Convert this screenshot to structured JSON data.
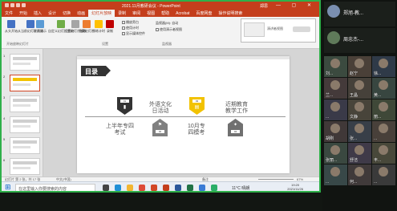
{
  "window": {
    "title": "2021.11月教研会议 - PowerPoint",
    "user_label": "郑思",
    "controls": "— ▢ ✕"
  },
  "menu": {
    "tabs": [
      "文件",
      "开始",
      "插入",
      "设计",
      "切换",
      "动画",
      "幻灯片放映",
      "录制",
      "审阅",
      "视图",
      "帮助",
      "Acrobat",
      "百度网盘",
      "操作说明搜索"
    ],
    "active_index": 6
  },
  "ribbon": {
    "buttons": [
      {
        "label": "从头开始",
        "color": "#4472c4"
      },
      {
        "label": "从当前幻灯片开始",
        "color": "#4472c4"
      },
      {
        "label": "联机演示",
        "color": "#5b9bd5"
      },
      {
        "label": "自定义幻灯片放映",
        "color": "#70ad47"
      },
      {
        "label": "设置幻灯片放映",
        "color": "#a5a5a5"
      },
      {
        "label": "隐藏幻灯片",
        "color": "#ed7d31"
      },
      {
        "label": "排练计时",
        "color": "#ffc000"
      },
      {
        "label": "录制",
        "color": "#c00000"
      }
    ],
    "checkboxes": [
      "播放旁白",
      "使用计时",
      "显示媒体控件"
    ],
    "monitor_field": "监视器(M): 自动",
    "presenter_view": "使用演示者视图",
    "groups": [
      "开始放映幻灯片",
      "设置",
      "监视器"
    ],
    "monitor_preview_label": "演讲者视图"
  },
  "thumbnails": [
    {
      "num": "1",
      "selected": false
    },
    {
      "num": "2",
      "selected": true
    },
    {
      "num": "3",
      "selected": false
    },
    {
      "num": "4",
      "selected": false
    },
    {
      "num": "5",
      "selected": false
    },
    {
      "num": "6",
      "selected": false
    }
  ],
  "slide": {
    "toc_label": "目录",
    "items": [
      {
        "num": "01",
        "caption": "上半年专四\n考试",
        "color": "#333333",
        "icon": "book-icon"
      },
      {
        "num": "02",
        "caption": "外语文化\n日活动",
        "color": "#808080",
        "icon": "flag-icon"
      },
      {
        "num": "03",
        "caption": "10月专\n四模考",
        "color": "#f2c200",
        "icon": "document-icon"
      },
      {
        "num": "04",
        "caption": "近期教育\n教学工作",
        "color": "#707070",
        "icon": "bird-icon"
      }
    ]
  },
  "statusbar": {
    "left": "幻灯片 第 2 张，共 17 张",
    "lang": "中文(中国)",
    "notes": "备注",
    "zoom": "67%"
  },
  "taskbar": {
    "search_placeholder": "在这里输入你要搜索的内容",
    "weather": "11°C 晴朗",
    "time": "19:20",
    "date": "2021/11/26",
    "app_icons": [
      {
        "name": "task-view-icon",
        "color": "#444444"
      },
      {
        "name": "edge-icon",
        "color": "#1f8fd6"
      },
      {
        "name": "explorer-icon",
        "color": "#f2b632"
      },
      {
        "name": "chrome-icon",
        "color": "#dd4b39"
      },
      {
        "name": "wps-icon",
        "color": "#d24726"
      },
      {
        "name": "powerpoint-icon",
        "color": "#c43e1c"
      },
      {
        "name": "word-icon",
        "color": "#2b579a"
      },
      {
        "name": "excel-icon",
        "color": "#217346"
      },
      {
        "name": "meeting-icon",
        "color": "#3a7bd5"
      },
      {
        "name": "wechat-icon",
        "color": "#2aae67"
      }
    ]
  },
  "participants": [
    {
      "name": "郑旭-教..."
    },
    {
      "name": "周忠杰-..."
    },
    {
      "name": "刘...",
      "bg": "#3b4a3f"
    },
    {
      "name": "赵宁",
      "bg": "#4a4038"
    },
    {
      "name": "徐...",
      "bg": "#2f3a48"
    },
    {
      "name": "兰...",
      "bg": "#443a3a"
    },
    {
      "name": "王晶",
      "bg": "#46413a"
    },
    {
      "name": "黄...",
      "bg": "#384640"
    },
    {
      "name": "...",
      "bg": "#3a3a48"
    },
    {
      "name": "文静",
      "bg": "#48443a"
    },
    {
      "name": "丽...",
      "bg": "#3f4838"
    },
    {
      "name": "胡刚",
      "bg": "#403838"
    },
    {
      "name": "张...",
      "bg": "#383f48"
    },
    {
      "name": "...",
      "bg": "#48403a"
    },
    {
      "name": "张丽...",
      "bg": "#3a4840"
    },
    {
      "name": "舒洁",
      "bg": "#3f3a48"
    },
    {
      "name": "丰...",
      "bg": "#48483a"
    },
    {
      "name": "...",
      "bg": "#384848"
    },
    {
      "name": "何...",
      "bg": "#403a3a"
    },
    {
      "name": "...",
      "bg": "#3a3a3a"
    }
  ]
}
